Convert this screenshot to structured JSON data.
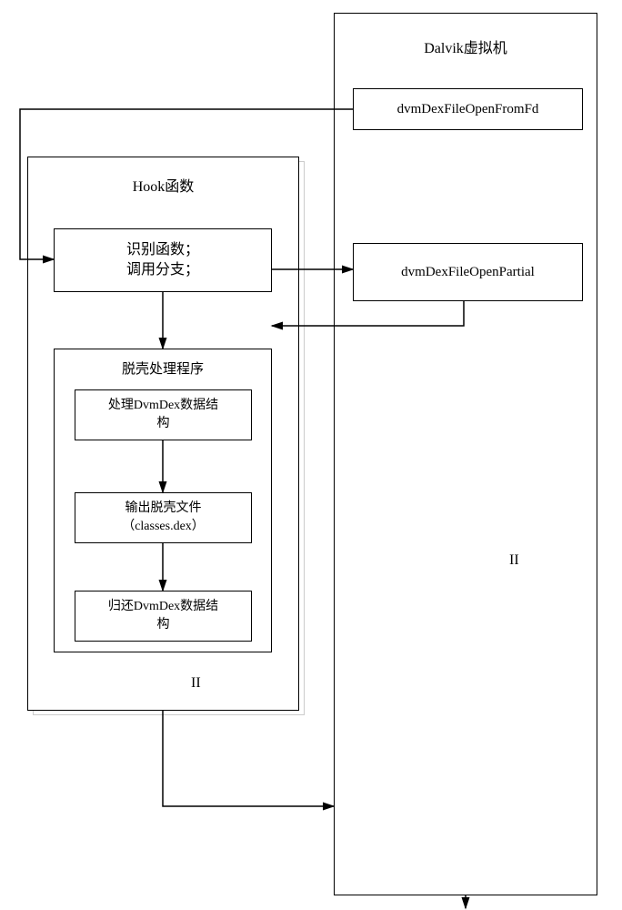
{
  "dalvik": {
    "title": "Dalvik虚拟机",
    "fn1": "dvmDexFileOpenFromFd",
    "fn2": "dvmDexFileOpenPartial",
    "marker": "II"
  },
  "hook": {
    "title": "Hook函数",
    "recognize_line1": "识别函数；",
    "recognize_line2": "调用分支；",
    "unshell_title": "脱壳处理程序",
    "step1_line1": "处理DvmDex数据结",
    "step1_line2": "构",
    "step2_line1": "输出脱壳文件",
    "step2_line2": "（classes.dex）",
    "step3_line1": "归还DvmDex数据结",
    "step3_line2": "构",
    "marker": "II"
  }
}
